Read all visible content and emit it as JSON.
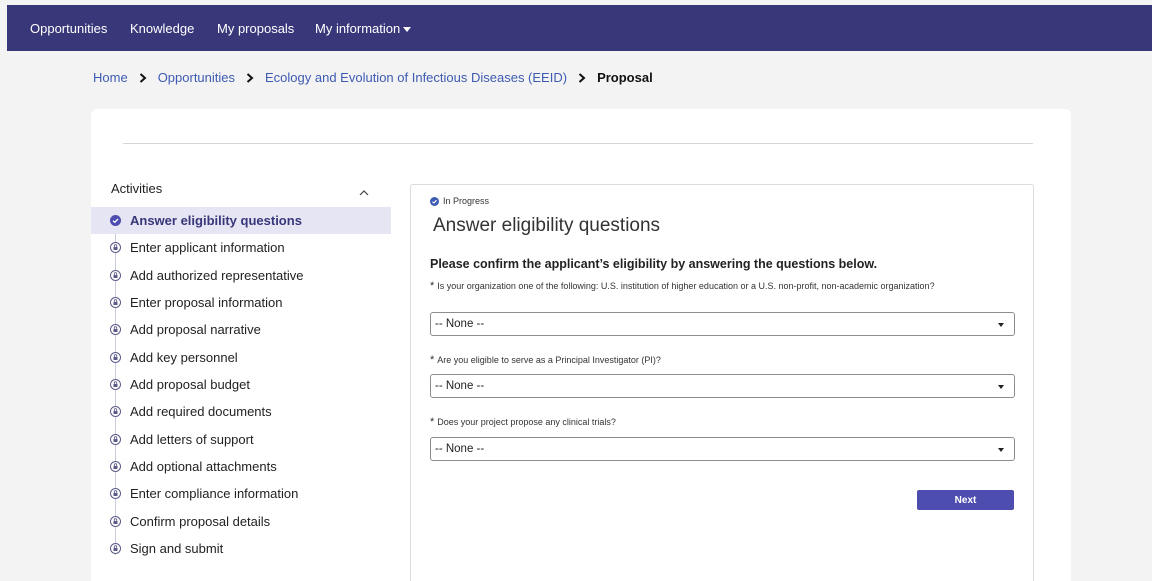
{
  "topnav": {
    "items": [
      "Opportunities",
      "Knowledge",
      "My proposals",
      "My information"
    ]
  },
  "breadcrumb": {
    "items": [
      "Home",
      "Opportunities",
      "Ecology and Evolution of Infectious Diseases (EEID)"
    ],
    "current": "Proposal"
  },
  "sidebar": {
    "title": "Activities",
    "steps": [
      {
        "label": "Answer eligibility questions",
        "icon": "check-circle-icon"
      },
      {
        "label": "Enter applicant information",
        "icon": "lock-icon"
      },
      {
        "label": "Add authorized representative",
        "icon": "lock-icon"
      },
      {
        "label": "Enter proposal information",
        "icon": "lock-icon"
      },
      {
        "label": "Add proposal narrative",
        "icon": "lock-icon"
      },
      {
        "label": "Add key personnel",
        "icon": "lock-icon"
      },
      {
        "label": "Add proposal budget",
        "icon": "lock-icon"
      },
      {
        "label": "Add required documents",
        "icon": "lock-icon"
      },
      {
        "label": "Add letters of support",
        "icon": "lock-icon"
      },
      {
        "label": "Add optional attachments",
        "icon": "lock-icon"
      },
      {
        "label": "Enter compliance information",
        "icon": "lock-icon"
      },
      {
        "label": "Confirm proposal details",
        "icon": "lock-icon"
      },
      {
        "label": "Sign and submit",
        "icon": "lock-icon"
      }
    ]
  },
  "main": {
    "status": "In Progress",
    "title": "Answer eligibility questions",
    "instructions": "Please confirm the applicant’s eligibility by answering the questions below.",
    "questions": [
      {
        "required": "*",
        "label": "Is your organization one of the following: U.S. institution of higher education or a U.S. non-profit, non-academic organization?",
        "value": "-- None --"
      },
      {
        "required": "*",
        "label": "Are you eligible to serve as a Principal Investigator (PI)?",
        "value": "-- None --"
      },
      {
        "required": "*",
        "label": "Does your project propose any clinical trials?",
        "value": "-- None --"
      }
    ],
    "next_label": "Next"
  },
  "colors": {
    "nav_bg": "#38377a",
    "link": "#3e5bb3",
    "accent": "#4d4db0",
    "active_bg": "#e5e5f4"
  }
}
